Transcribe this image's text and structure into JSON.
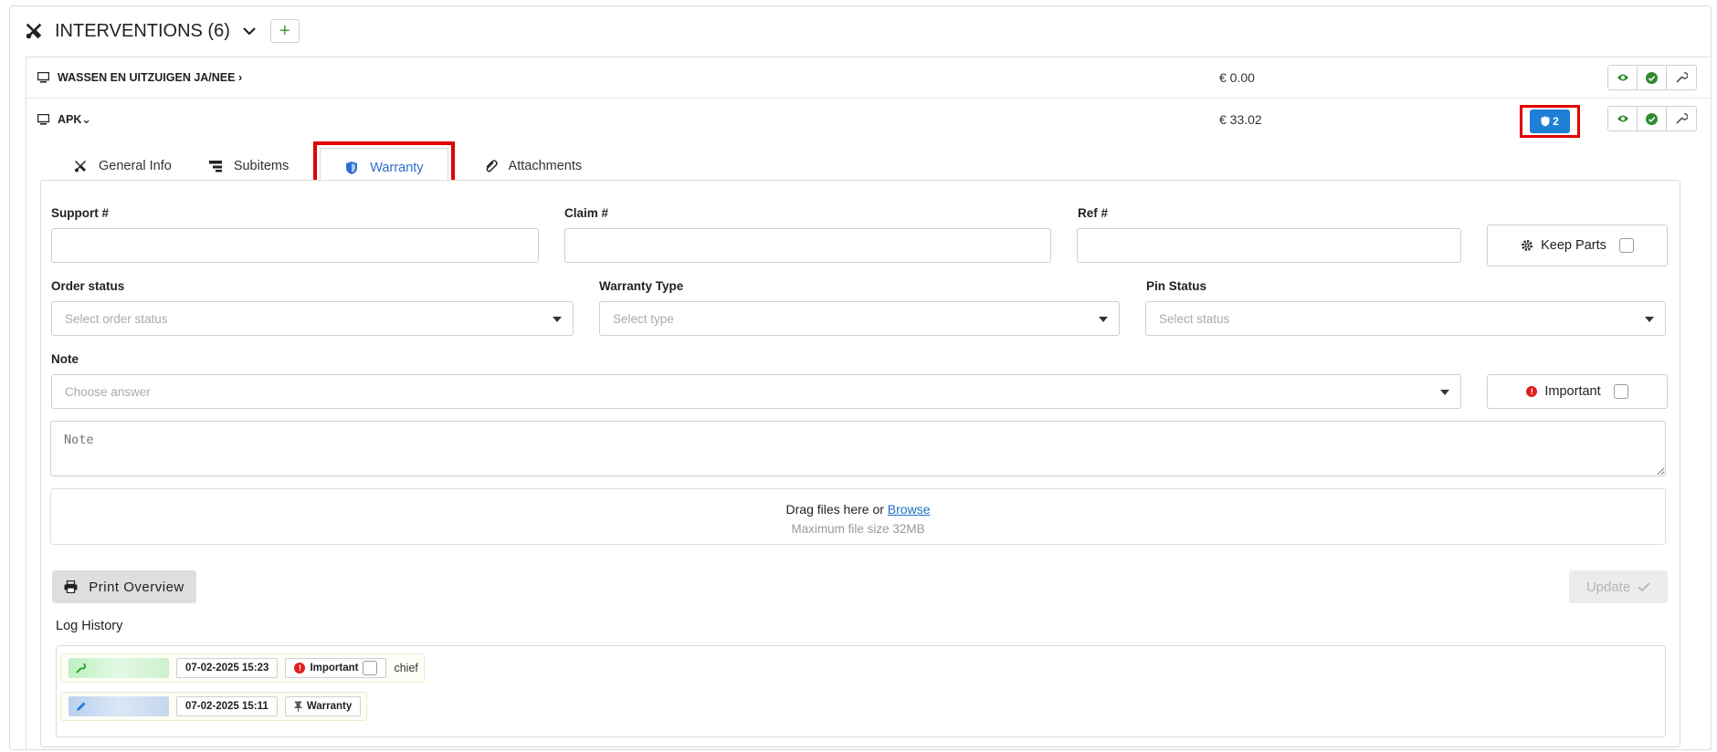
{
  "header": {
    "title": "INTERVENTIONS (6)",
    "add_label": "+"
  },
  "interventions": [
    {
      "name": "WASSEN EN UITZUIGEN JA/NEE ›",
      "price": "€ 0.00"
    },
    {
      "name": "APK⌄",
      "price": "€ 33.02",
      "warranty_count": "2"
    }
  ],
  "tabs": [
    {
      "label": "General Info",
      "icon": "tools-icon"
    },
    {
      "label": "Subitems",
      "icon": "subitems-icon"
    },
    {
      "label": "Warranty",
      "icon": "shield-icon",
      "active": true
    },
    {
      "label": "Attachments",
      "icon": "paperclip-icon"
    }
  ],
  "form": {
    "support_label": "Support #",
    "claim_label": "Claim #",
    "ref_label": "Ref #",
    "keep_parts_label": "Keep Parts",
    "order_status_label": "Order status",
    "order_status_placeholder": "Select order status",
    "warranty_type_label": "Warranty Type",
    "warranty_type_placeholder": "Select type",
    "pin_status_label": "Pin Status",
    "pin_status_placeholder": "Select status",
    "note_label": "Note",
    "note_select_placeholder": "Choose answer",
    "important_label": "Important",
    "note_placeholder": "Note"
  },
  "upload": {
    "drag_text": "Drag files here or ",
    "browse_text": "Browse",
    "max_size": "Maximum file size 32MB"
  },
  "actions": {
    "print_label": "Print Overview",
    "update_label": "Update"
  },
  "log": {
    "title": "Log History",
    "entries": [
      {
        "icon": "wrench-icon",
        "timestamp": "07-02-2025 15:23",
        "tag": "Important",
        "extra": "chief"
      },
      {
        "icon": "pencil-icon",
        "timestamp": "07-02-2025 15:11",
        "tag": "Warranty"
      }
    ]
  },
  "colors": {
    "accent_blue": "#1f7fd6",
    "active_tab": "#2f6fd0",
    "success_green": "#3a9a3a",
    "highlight_red": "#e00000"
  }
}
